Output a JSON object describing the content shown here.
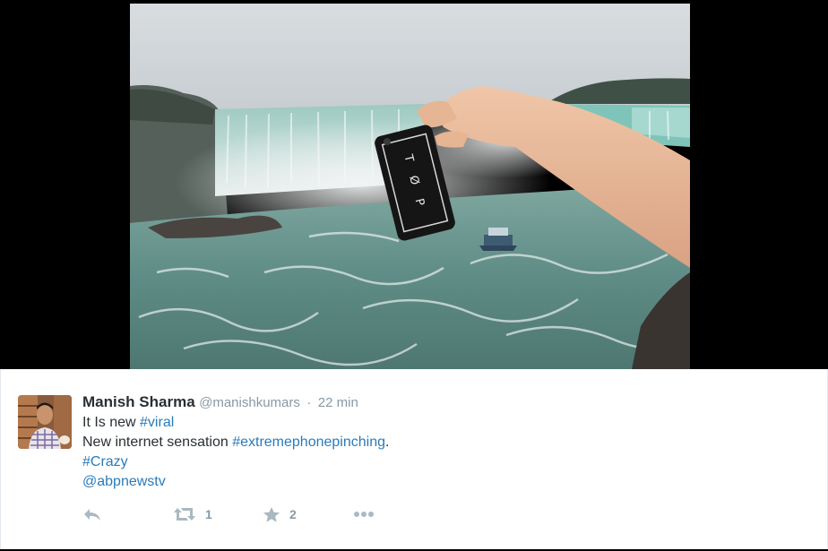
{
  "tweet": {
    "fullname": "Manish Sharma",
    "username": "@manishkumars",
    "separator": "·",
    "timestamp": "22 min",
    "text": {
      "line1_prefix": "It Is new ",
      "line1_hashtag": "#viral",
      "line2_prefix": "New internet sensation ",
      "line2_hashtag": "#extremephonepinching",
      "line2_suffix": ".",
      "line3_hashtag": "#Crazy",
      "line4_mention": "@abpnewstv"
    },
    "actions": {
      "reply_icon": "reply-icon",
      "retweet_icon": "retweet-icon",
      "retweet_count": "1",
      "favorite_icon": "star-icon",
      "favorite_count": "2",
      "more_icon": "more-dots-icon"
    }
  },
  "media": {
    "phone_case_text": "T Ø P"
  },
  "colors": {
    "link": "#2b7bb9",
    "text": "#292f33",
    "muted": "#8899a6",
    "backdrop": "#000000"
  }
}
